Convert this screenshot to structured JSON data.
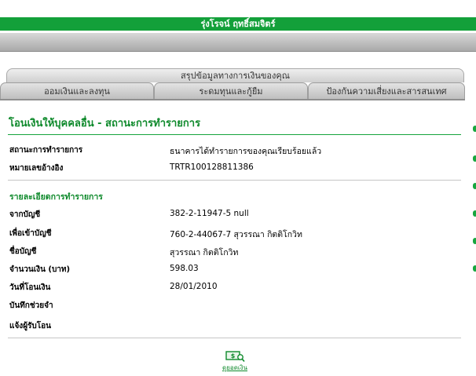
{
  "header": {
    "faint_text": "",
    "banner_title": "รุ่งโรจน์ ฤทธิ์สมจิตร์"
  },
  "tabs": {
    "summary_label": "สรุปข้อมูลทางการเงินของคุณ",
    "items": [
      {
        "label": "ออมเงินและลงทุน"
      },
      {
        "label": "ระดมทุนและกู้ยืม"
      },
      {
        "label": "ป้องกันความเสี่ยงและสารสนเทศ"
      }
    ]
  },
  "page": {
    "title": "โอนเงินให้บุคคลอื่น - สถานะการทำรายการ"
  },
  "status": {
    "status_label": "สถานะการทำรายการ",
    "status_value": "ธนาคารได้ทำรายการของคุณเรียบร้อยแล้ว",
    "ref_label": "หมายเลขอ้างอิง",
    "ref_value": "TRTR100128811386"
  },
  "details": {
    "section_title": "รายละเอียดการทำรายการ",
    "rows": [
      {
        "label": "จากบัญชี",
        "value": "382-2-11947-5 null"
      },
      {
        "label": "เพื่อเข้าบัญชี",
        "value": "760-2-44067-7 สุวรรณา กิตติโกวิท"
      },
      {
        "label": "ชื่อบัญชี",
        "value": "สุวรรณา กิตติโกวิท"
      },
      {
        "label": "จำนวนเงิน (บาท)",
        "value": "598.03"
      },
      {
        "label": "วันที่โอนเงิน",
        "value": "28/01/2010"
      },
      {
        "label": "บันทึกช่วยจำ",
        "value": ""
      },
      {
        "label": "แจ้งผู้รับโอน",
        "value": ""
      }
    ]
  },
  "actions": {
    "view_balance_label": "ดูยอดเงิน",
    "view_balance_icon": "money-search-icon"
  },
  "colors": {
    "brand_green": "#13a03a",
    "title_green": "#0f8a2c"
  }
}
